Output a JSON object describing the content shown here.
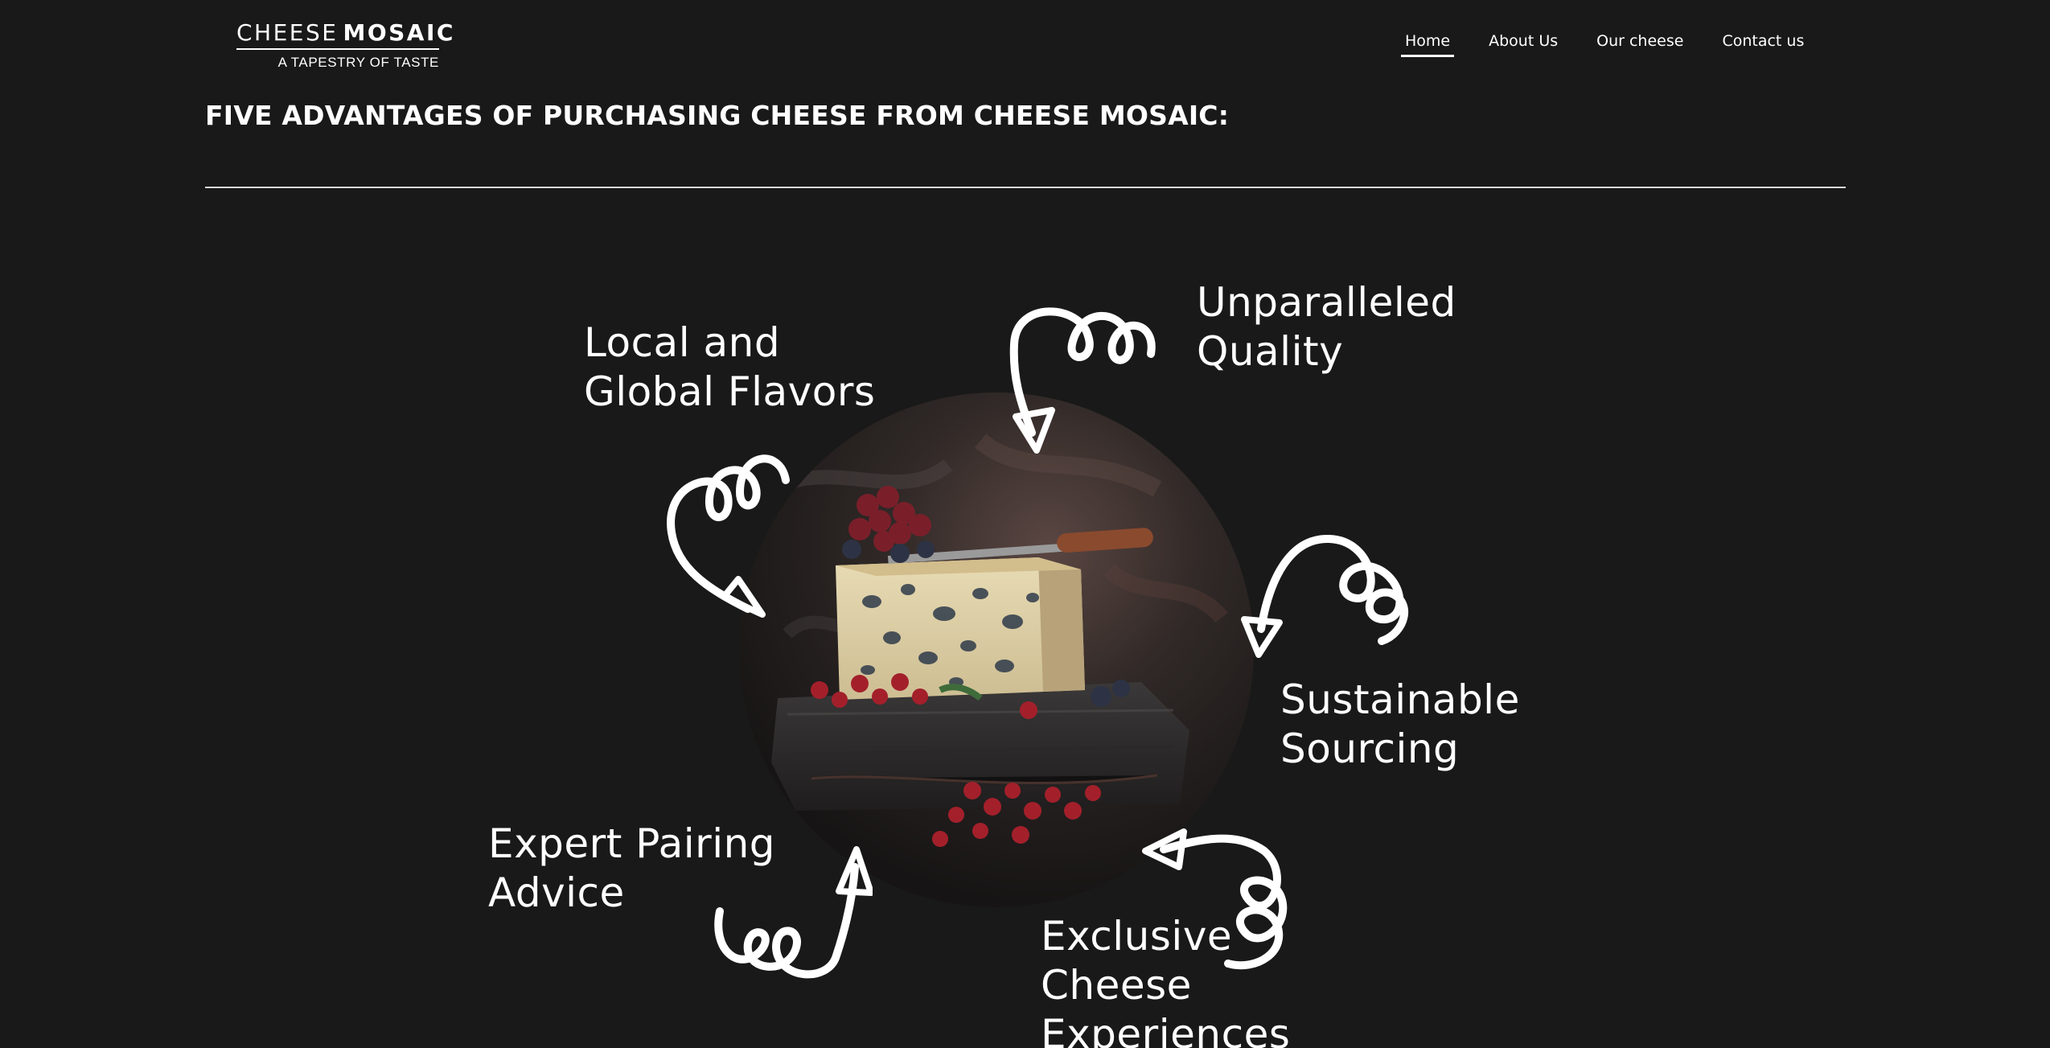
{
  "header": {
    "logo": {
      "word_light": "CHEESE",
      "word_bold": "MOSAIC",
      "tagline": "A TAPESTRY OF TASTE"
    },
    "nav": [
      {
        "label": "Home",
        "active": true
      },
      {
        "label": "About Us",
        "active": false
      },
      {
        "label": "Our cheese",
        "active": false
      },
      {
        "label": "Contact us",
        "active": false
      }
    ]
  },
  "main": {
    "section_title": "FIVE ADVANTAGES OF PURCHASING CHEESE FROM CHEESE MOSAIC:",
    "advantages": [
      {
        "label": "Local and\nGlobal Flavors"
      },
      {
        "label": "Unparalleled\nQuality"
      },
      {
        "label": "Sustainable\nSourcing"
      },
      {
        "label": "Expert Pairing\nAdvice"
      },
      {
        "label": "Exclusive\nCheese\nExperiences"
      }
    ],
    "image": {
      "subject": "blue cheese wedge with red berries on dark slate"
    }
  },
  "colors": {
    "background": "#191919",
    "text": "#ffffff",
    "divider": "#d8d8d8"
  },
  "icons": [
    "curly-arrow-icon"
  ]
}
